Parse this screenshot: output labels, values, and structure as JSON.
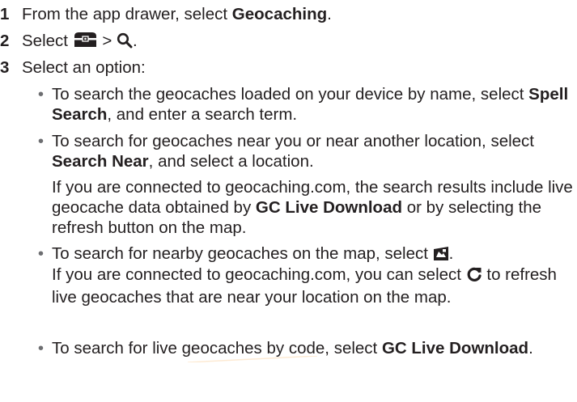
{
  "steps": [
    {
      "number": "1",
      "before": "From the app drawer, select ",
      "bold": "Geocaching",
      "after": "."
    },
    {
      "number": "2",
      "before": "Select ",
      "sep": " > ",
      "after": "."
    },
    {
      "number": "3",
      "text": "Select an option:"
    }
  ],
  "options": [
    {
      "before": "To search the geocaches loaded on your device by name, select ",
      "bold": "Spell Search",
      "after": ", and enter a search term."
    },
    {
      "before": "To search for geocaches near you or near another location, select ",
      "bold": "Search Near",
      "after": ", and select a location."
    },
    {
      "before": "To search for nearby geocaches on the map, select ",
      "after": "."
    },
    {
      "before": "To search for live geocaches by code, select ",
      "bold": "GC Live Download",
      "after": "."
    }
  ],
  "notes": {
    "live_search": {
      "before": "If you are connected to geocaching.com, the search results include live geocache data obtained by ",
      "bold": "GC Live Download",
      "after": " or by selecting the refresh button on the map."
    },
    "refresh": {
      "before": "If you are connected to geocaching.com, you can select ",
      "after": " to refresh live geocaches that are near your location on the map."
    }
  },
  "bullet_char": "•",
  "icons": [
    "geocache-box-icon",
    "search-icon",
    "map-geocache-icon",
    "refresh-icon"
  ],
  "colors": {
    "text": "#231f20",
    "bullet": "#6d6e71",
    "watermark": "#f7941d"
  }
}
